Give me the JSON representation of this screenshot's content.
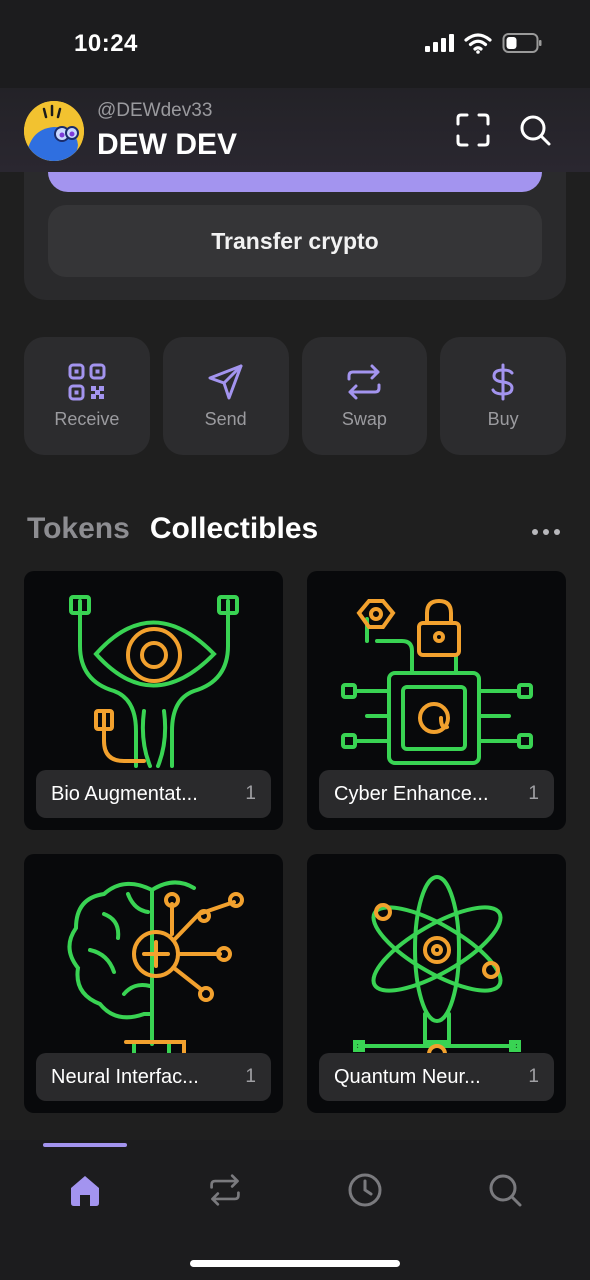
{
  "status_bar": {
    "time": "10:24"
  },
  "header": {
    "handle": "@DEWdev33",
    "name": "DEW DEV"
  },
  "wallet": {
    "transfer_label": "Transfer crypto"
  },
  "actions": [
    {
      "label": "Receive",
      "icon": "qr-code-icon"
    },
    {
      "label": "Send",
      "icon": "send-icon"
    },
    {
      "label": "Swap",
      "icon": "swap-icon"
    },
    {
      "label": "Buy",
      "icon": "dollar-icon"
    }
  ],
  "tabs": {
    "tokens": "Tokens",
    "collectibles": "Collectibles"
  },
  "collectibles": [
    {
      "name": "Bio Augmentat...",
      "count": "1"
    },
    {
      "name": "Cyber Enhance...",
      "count": "1"
    },
    {
      "name": "Neural Interfac...",
      "count": "1"
    },
    {
      "name": "Quantum Neur...",
      "count": "1"
    }
  ],
  "colors": {
    "accent": "#a394ef",
    "neon_green": "#39d353",
    "neon_orange": "#f2a12e"
  }
}
